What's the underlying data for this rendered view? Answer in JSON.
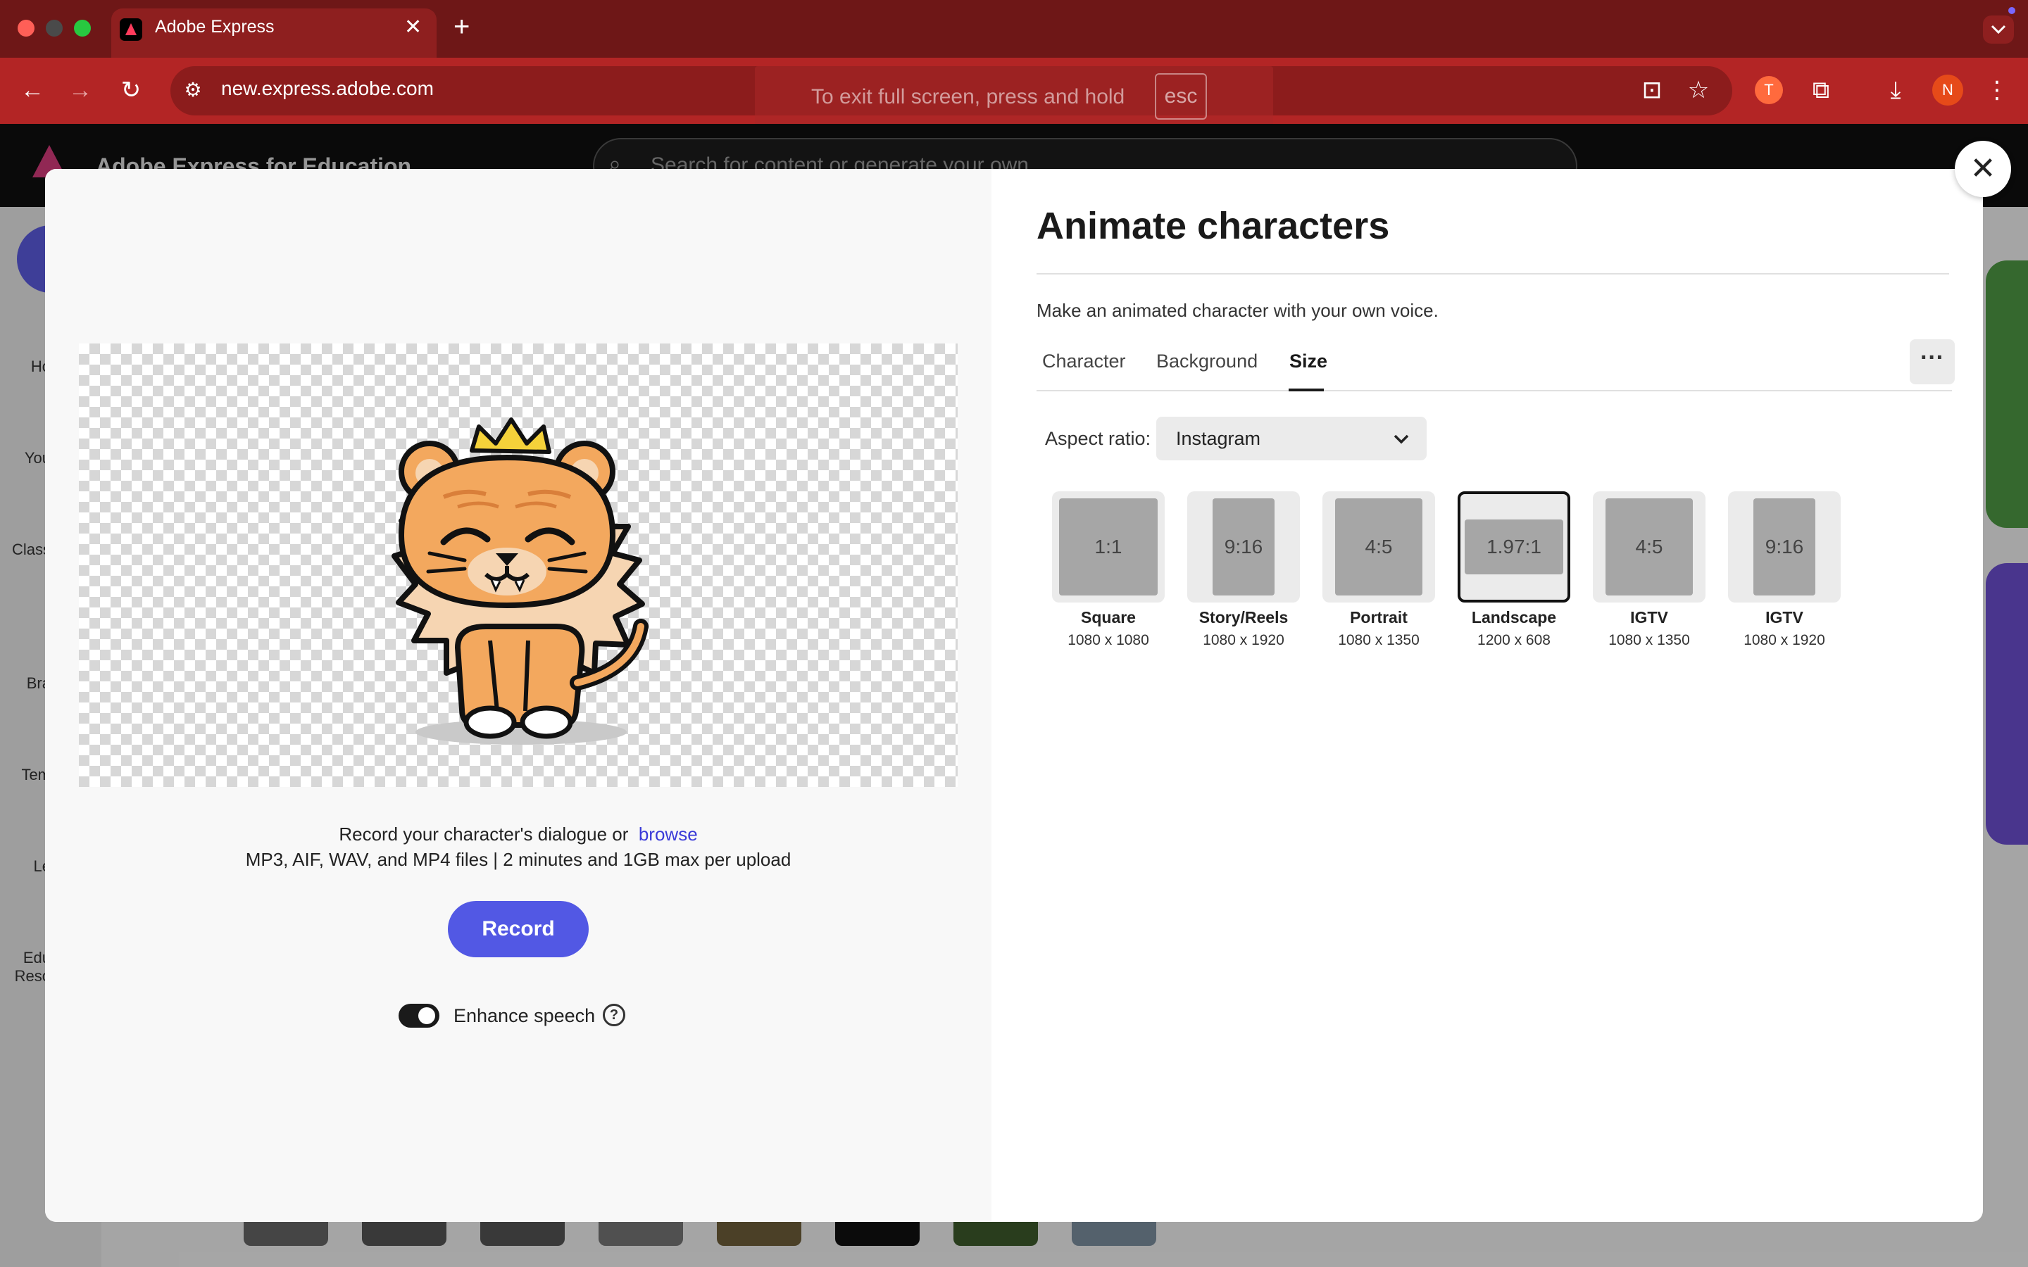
{
  "browser": {
    "tab_title": "Adobe Express",
    "tab_close": "✕",
    "new_tab": "+",
    "url": "new.express.adobe.com",
    "fullscreen_hint": "To exit full screen, press and hold",
    "fullscreen_key": "esc",
    "profile_initial": "N",
    "menu_icon": "chevron-down",
    "nav": {
      "back": "←",
      "forward": "→",
      "reload": "↻",
      "site_info": "⚙"
    },
    "toolbar_icons": {
      "install": "⊡",
      "bookmark": "☆",
      "extension": "⧉",
      "download": "⤓",
      "more": "⋮"
    }
  },
  "app": {
    "title": "Adobe Express for Education",
    "search_placeholder": "Search for content or generate your own",
    "sidebar": [
      "Ho",
      "You",
      "Class",
      "Bra",
      "Tem",
      "Le",
      "Edu Reso"
    ]
  },
  "modal": {
    "close": "✕",
    "title": "Animate characters",
    "description": "Make an animated character with your own voice.",
    "tabs": [
      "Character",
      "Background",
      "Size"
    ],
    "active_tab": "Size",
    "more": "···",
    "aspect_label": "Aspect ratio:",
    "aspect_value": "Instagram",
    "chevron": "⌄",
    "sizes": [
      {
        "ratio": "1:1",
        "name": "Square",
        "dims": "1080 x 1080"
      },
      {
        "ratio": "9:16",
        "name": "Story/Reels",
        "dims": "1080 x 1920"
      },
      {
        "ratio": "4:5",
        "name": "Portrait",
        "dims": "1080 x 1350"
      },
      {
        "ratio": "1.97:1",
        "name": "Landscape",
        "dims": "1200 x 608",
        "selected": true
      },
      {
        "ratio": "4:5",
        "name": "IGTV",
        "dims": "1080 x 1350"
      },
      {
        "ratio": "9:16",
        "name": "IGTV",
        "dims": "1080 x 1920"
      }
    ],
    "record_prompt": "Record your character's dialogue or",
    "browse_label": "browse",
    "formats": "MP3, AIF, WAV, and MP4 files | 2 minutes and 1GB max per upload",
    "record_button": "Record",
    "enhance_label": "Enhance speech",
    "enhance_on": true,
    "help": "?"
  },
  "colors": {
    "tabbar": "#6e1717",
    "toolbar": "#b32525",
    "record_button": "#5258e4",
    "link": "#3b3bd8"
  }
}
